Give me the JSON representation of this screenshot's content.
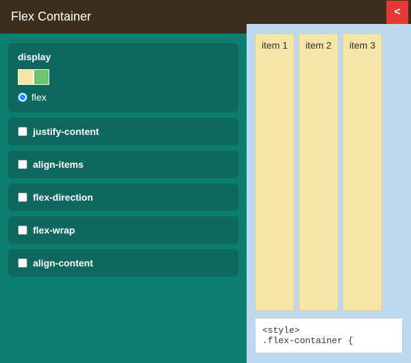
{
  "header": {
    "title": "Flex Container"
  },
  "sidebar": {
    "display_group": {
      "title": "display",
      "option_label": "flex"
    },
    "props": [
      {
        "label": "justify-content"
      },
      {
        "label": "align-items"
      },
      {
        "label": "flex-direction"
      },
      {
        "label": "flex-wrap"
      },
      {
        "label": "align-content"
      }
    ]
  },
  "toolbar": {
    "back_label": "<"
  },
  "preview": {
    "items": [
      {
        "label": "item 1"
      },
      {
        "label": "item 2"
      },
      {
        "label": "item 3"
      }
    ]
  },
  "code": {
    "line1": "<style>",
    "line2": ".flex-container {"
  }
}
